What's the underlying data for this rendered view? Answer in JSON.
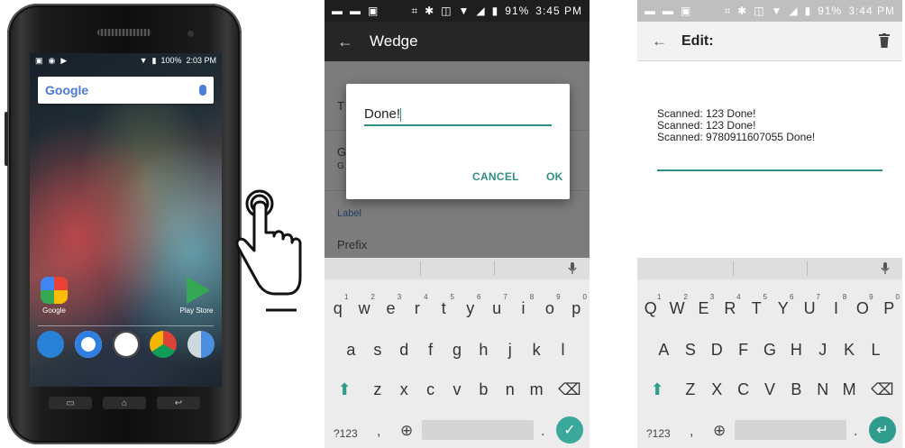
{
  "phone": {
    "status_time": "2:03 PM",
    "status_battery": "100%",
    "search_logo": "Google",
    "apps": [
      {
        "label": "Google",
        "icon": "google-app-icon"
      },
      {
        "label": "Play Store",
        "icon": "play-store-icon"
      }
    ],
    "dock": [
      "phone-icon",
      "messages-icon",
      "app-drawer-icon",
      "chrome-icon",
      "camera-icon"
    ]
  },
  "middle": {
    "status_battery": "91%",
    "status_time": "3:45 PM",
    "title": "Wedge",
    "list_rows": [
      "T",
      "G",
      "G"
    ],
    "label_header": "Label",
    "prefix_row": "Prefix",
    "dialog": {
      "input_value": "Done!",
      "cancel_label": "CANCEL",
      "ok_label": "OK"
    }
  },
  "right": {
    "status_battery": "91%",
    "status_time": "3:44 PM",
    "title": "Edit:",
    "lines": [
      "Scanned: 123 Done!",
      "Scanned: 123 Done!",
      "Scanned: 9780911607055 Done!"
    ]
  },
  "keyboard_lower": {
    "row1": [
      "q",
      "w",
      "e",
      "r",
      "t",
      "y",
      "u",
      "i",
      "o",
      "p"
    ],
    "row2": [
      "a",
      "s",
      "d",
      "f",
      "g",
      "h",
      "j",
      "k",
      "l"
    ],
    "row3": [
      "z",
      "x",
      "c",
      "v",
      "b",
      "n",
      "m"
    ],
    "numbers": [
      "1",
      "2",
      "3",
      "4",
      "5",
      "6",
      "7",
      "8",
      "9",
      "0"
    ],
    "symbols_key": "?123",
    "comma": ",",
    "period": "."
  },
  "keyboard_upper": {
    "row1": [
      "Q",
      "W",
      "E",
      "R",
      "T",
      "Y",
      "U",
      "I",
      "O",
      "P"
    ],
    "row2": [
      "A",
      "S",
      "D",
      "F",
      "G",
      "H",
      "J",
      "K",
      "L"
    ],
    "row3": [
      "Z",
      "X",
      "C",
      "V",
      "B",
      "N",
      "M"
    ],
    "numbers": [
      "1",
      "2",
      "3",
      "4",
      "5",
      "6",
      "7",
      "8",
      "9",
      "0"
    ],
    "symbols_key": "?123",
    "comma": ",",
    "period": "."
  }
}
